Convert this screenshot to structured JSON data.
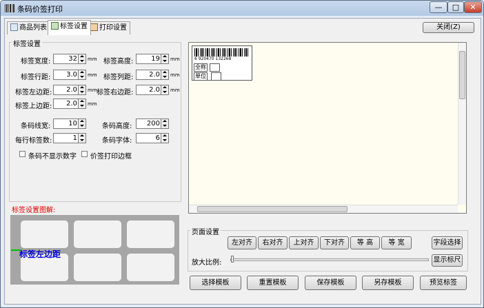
{
  "window": {
    "title": "条码价签打印",
    "minimize_label": "—",
    "maximize_label": "□",
    "close_label": "✕"
  },
  "tabs": [
    {
      "label": "商品列表"
    },
    {
      "label": "标签设置"
    },
    {
      "label": "打印设置"
    }
  ],
  "close_button": "关闭(Z)",
  "settings": {
    "group_title": "标签设置",
    "label_width": {
      "label": "标签宽度:",
      "value": "32",
      "unit": "mm"
    },
    "label_height": {
      "label": "标签高度:",
      "value": "19",
      "unit": "mm"
    },
    "row_spacing": {
      "label": "标签行距:",
      "value": "3.0",
      "unit": "mm"
    },
    "col_spacing": {
      "label": "标签列距:",
      "value": "2.0",
      "unit": "mm"
    },
    "left_margin": {
      "label": "标签左边距:",
      "value": "2.0",
      "unit": "mm"
    },
    "right_margin": {
      "label": "标签右边距:",
      "value": "2.0",
      "unit": "mm"
    },
    "top_margin": {
      "label": "标签上边距:",
      "value": "2.0",
      "unit": "mm"
    },
    "barcode_line_width": {
      "label": "条码线宽:",
      "value": "10"
    },
    "barcode_height": {
      "label": "条码高度:",
      "value": "200"
    },
    "labels_per_row": {
      "label": "每行标签数:",
      "value": "1"
    },
    "barcode_font": {
      "label": "条码字体:",
      "value": "6"
    },
    "hide_digits": {
      "label": "条码不显示数字",
      "checked": false
    },
    "print_border": {
      "label": "价签打印边框",
      "checked": false
    }
  },
  "diagram": {
    "title": "标签设置图解:",
    "label": "标签左边距"
  },
  "preview": {
    "barcode_number": "6 920470 132268",
    "field_fullname": "全称",
    "field_unit": "单位"
  },
  "page_settings": {
    "group_title": "页面设置",
    "buttons": [
      "左对齐",
      "右对齐",
      "上对齐",
      "下对齐",
      "等 高",
      "等 宽"
    ],
    "field_select": "字段选择",
    "zoom_label": "放大比例:",
    "zoom_level": 0.0,
    "show_ruler": "显示标尺"
  },
  "bottom_buttons": [
    "选择模板",
    "重置模板",
    "保存模板",
    "另存模板",
    "预览标签"
  ]
}
